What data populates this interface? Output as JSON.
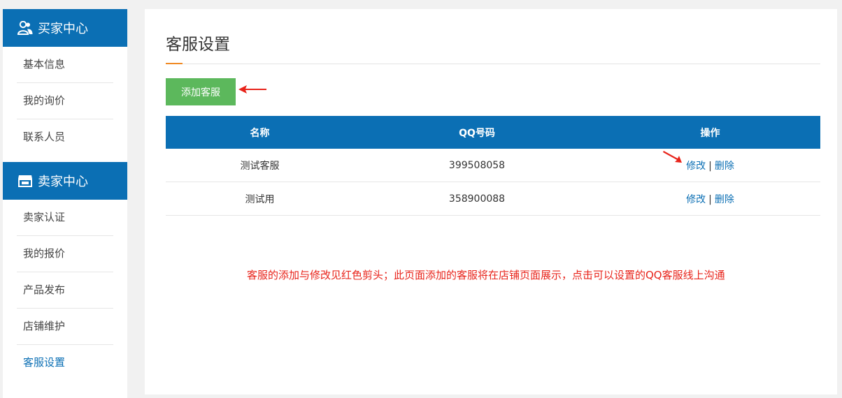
{
  "sidebar": {
    "buyer": {
      "title": "买家中心",
      "icon": "user-group-icon",
      "items": [
        "基本信息",
        "我的询价",
        "联系人员"
      ]
    },
    "seller": {
      "title": "卖家中心",
      "icon": "store-icon",
      "items": [
        "卖家认证",
        "我的报价",
        "产品发布",
        "店铺维护",
        "客服设置"
      ]
    },
    "active_item": "客服设置"
  },
  "main": {
    "title": "客服设置",
    "add_button": "添加客服",
    "table": {
      "headers": [
        "名称",
        "QQ号码",
        "操作"
      ],
      "rows": [
        {
          "name": "测试客服",
          "qq": "399508058",
          "edit": "修改",
          "sep": "|",
          "delete": "删除"
        },
        {
          "name": "测试用",
          "qq": "358900088",
          "edit": "修改",
          "sep": "|",
          "delete": "删除"
        }
      ]
    },
    "note": "客服的添加与修改见红色剪头；此页面添加的客服将在店铺页面展示，点击可以设置的QQ客服线上沟通"
  },
  "colors": {
    "primary": "#0b6fb4",
    "button_green": "#5cb85c",
    "accent_orange": "#f08a24",
    "annotation_red": "#e8231a"
  }
}
